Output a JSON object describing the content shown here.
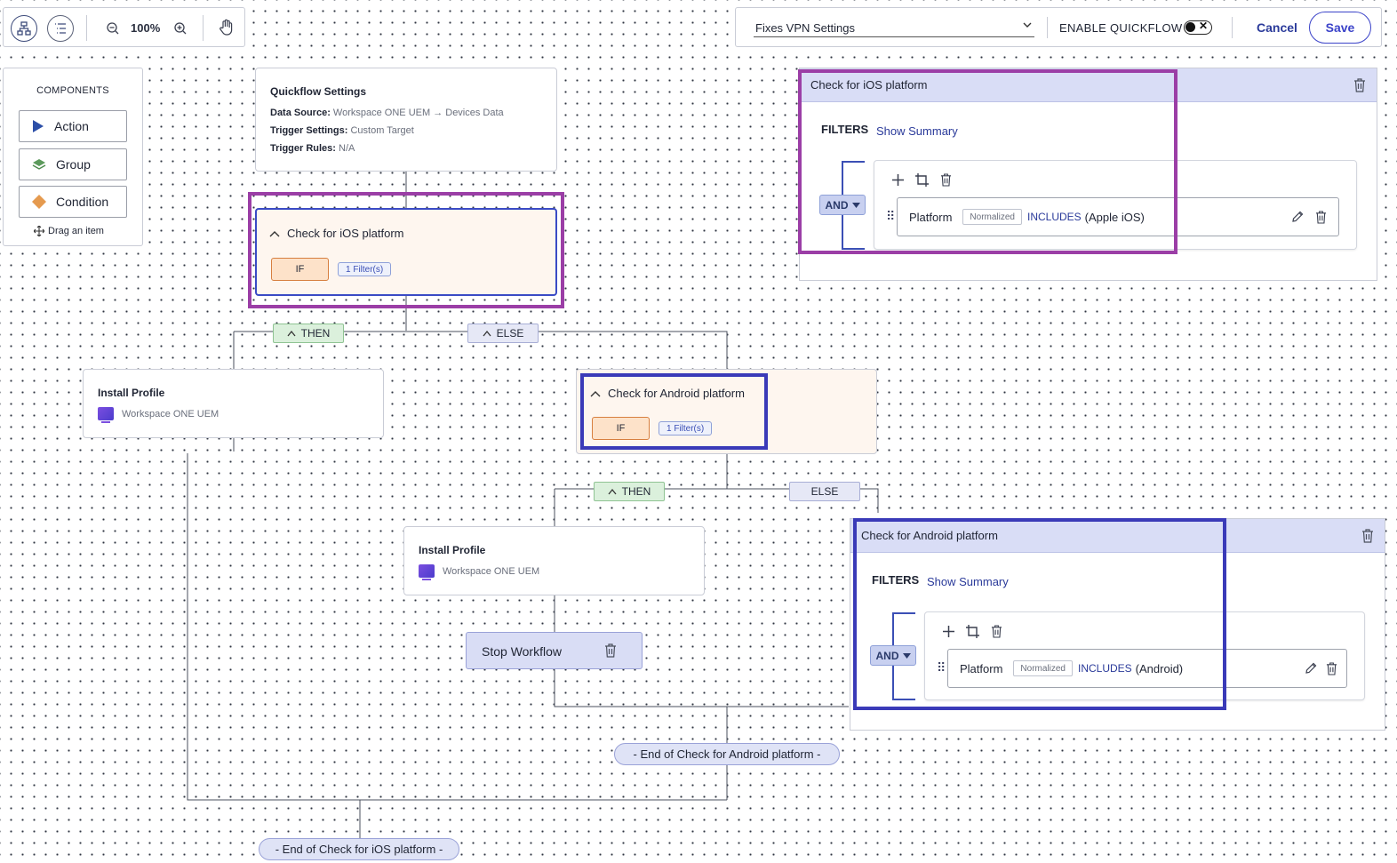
{
  "toolbar": {
    "zoom": "100%",
    "workflow_name": "Fixes VPN Settings",
    "enable_label": "ENABLE QUICKFLOW",
    "cancel": "Cancel",
    "save": "Save"
  },
  "components": {
    "title": "COMPONENTS",
    "items": [
      {
        "label": "Action",
        "icon": "play-triangle-icon",
        "color": "#2c4fa8"
      },
      {
        "label": "Group",
        "icon": "layers-icon",
        "color": "#4a8a4a"
      },
      {
        "label": "Condition",
        "icon": "diamond-icon",
        "color": "#e59a4f"
      }
    ],
    "drag_hint": "Drag an item"
  },
  "quickflow": {
    "title": "Quickflow Settings",
    "rows": [
      {
        "label": "Data Source:",
        "value": "Workspace ONE UEM → Devices Data"
      },
      {
        "label": "Trigger Settings:",
        "value": "Custom Target"
      },
      {
        "label": "Trigger Rules:",
        "value": "N/A"
      }
    ]
  },
  "ios_condition": {
    "title": "Check for iOS platform",
    "if": "IF",
    "filters": "1 Filter(s)"
  },
  "android_condition": {
    "title": "Check for Android platform",
    "if": "IF",
    "filters": "1 Filter(s)"
  },
  "branches": {
    "then": "THEN",
    "else": "ELSE"
  },
  "install_profile_1": {
    "title": "Install Profile",
    "sub": "Workspace ONE UEM"
  },
  "install_profile_2": {
    "title": "Install Profile",
    "sub": "Workspace ONE UEM"
  },
  "stop": {
    "label": "Stop Workflow"
  },
  "end_android": "- End of Check for Android platform -",
  "end_ios": "- End of Check for iOS platform -",
  "ios_panel": {
    "title": "Check for iOS platform",
    "filters_label": "FILTERS",
    "show_summary": "Show Summary",
    "and": "AND",
    "rule": {
      "field": "Platform",
      "badge": "Normalized",
      "op": "INCLUDES",
      "value": "(Apple iOS)"
    }
  },
  "android_panel": {
    "title": "Check for Android platform",
    "filters_label": "FILTERS",
    "show_summary": "Show Summary",
    "and": "AND",
    "rule": {
      "field": "Platform",
      "badge": "Normalized",
      "op": "INCLUDES",
      "value": "(Android)"
    }
  },
  "colors": {
    "accent": "#3b43c9",
    "highlight_purple": "#9b3ea6",
    "highlight_blue": "#3a3ab8",
    "condition_bg": "#fef6ef",
    "then_bg": "#dbf0dc",
    "else_bg": "#e6e8f6"
  }
}
